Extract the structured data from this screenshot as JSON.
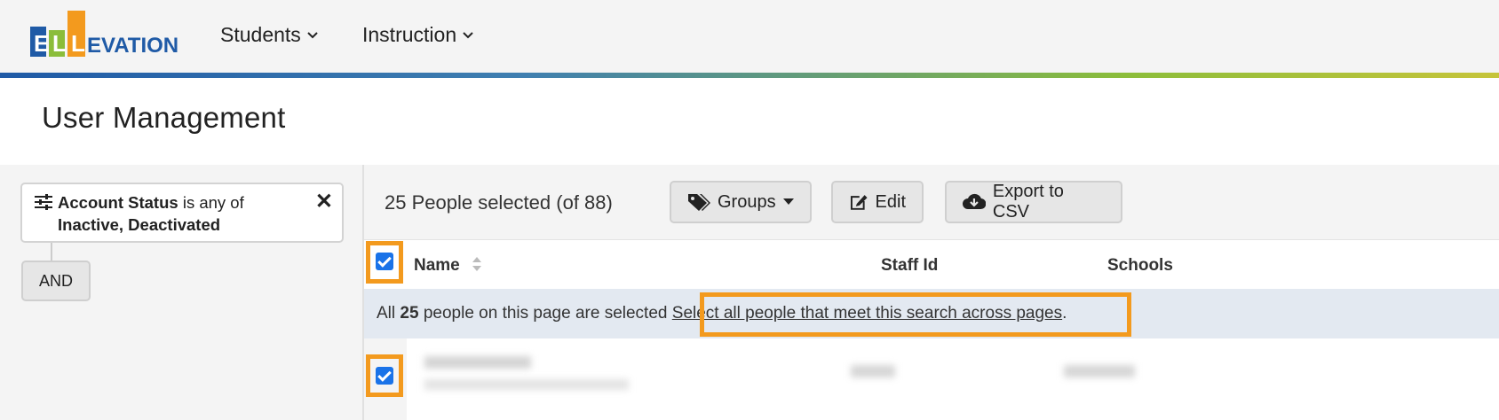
{
  "brand": {
    "logo_letters": [
      "E",
      "L",
      "L"
    ],
    "logo_text": "EVATION",
    "colors": {
      "blue": "#1f5aa6",
      "green": "#8bbd3a",
      "orange": "#f39a1e",
      "accent": "#1a73e8"
    }
  },
  "nav": {
    "items": [
      {
        "label": "Students",
        "icon": "chevron-down-icon"
      },
      {
        "label": "Instruction",
        "icon": "chevron-down-icon"
      }
    ]
  },
  "page": {
    "title": "User Management"
  },
  "filter": {
    "field": "Account Status",
    "operator": "is any of",
    "values": "Inactive, Deactivated",
    "icon": "sliders-icon",
    "remove_icon": "close-icon",
    "remove_symbol": "✕",
    "connector_label": "AND"
  },
  "toolbar": {
    "selection_text": "25 People selected (of 88)",
    "groups_label": "Groups",
    "edit_label": "Edit",
    "export_label": "Export to CSV"
  },
  "table": {
    "columns": [
      "Name",
      "Staff Id",
      "Schools"
    ],
    "header_checkbox_checked": true
  },
  "banner": {
    "prefix": "All ",
    "count": "25",
    "suffix": " people on this page are selected ",
    "link": "Select all people that meet this search across pages",
    "period": "."
  },
  "rows": [
    {
      "checked": true
    }
  ]
}
